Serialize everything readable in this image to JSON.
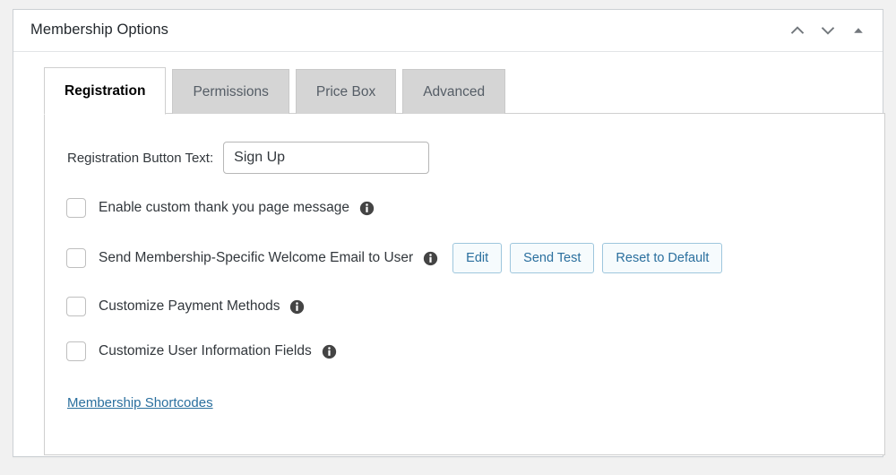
{
  "panel": {
    "title": "Membership Options",
    "header_actions": [
      {
        "name": "move-up-icon",
        "glyph": "chevron-up"
      },
      {
        "name": "move-down-icon",
        "glyph": "chevron-down"
      },
      {
        "name": "toggle-panel-icon",
        "glyph": "triangle-up"
      }
    ]
  },
  "tabs": [
    {
      "label": "Registration",
      "active": true
    },
    {
      "label": "Permissions",
      "active": false
    },
    {
      "label": "Price Box",
      "active": false
    },
    {
      "label": "Advanced",
      "active": false
    }
  ],
  "registration": {
    "button_text_label": "Registration Button Text:",
    "button_text_value": "Sign Up",
    "button_text_placeholder": "",
    "options": [
      {
        "label": "Enable custom thank you page message",
        "checked": false,
        "info": "info-icon"
      },
      {
        "label": "Send Membership-Specific Welcome Email to User",
        "checked": false,
        "info": "info-icon",
        "buttons": [
          "Edit",
          "Send Test",
          "Reset to Default"
        ]
      },
      {
        "label": "Customize Payment Methods",
        "checked": false,
        "info": "info-icon"
      },
      {
        "label": "Customize User Information Fields",
        "checked": false,
        "info": "info-icon"
      }
    ],
    "shortcodes_link": "Membership Shortcodes"
  },
  "colors": {
    "page_background": "#f1f1f1",
    "panel_background": "#ffffff",
    "panel_border": "#ccd0d4",
    "tab_inactive_background": "#d5d5d5",
    "link_blue": "#2a6f9e",
    "button_border_blue": "#9ec6dd",
    "info_icon_fill": "#444444",
    "text_primary": "#32373c"
  }
}
